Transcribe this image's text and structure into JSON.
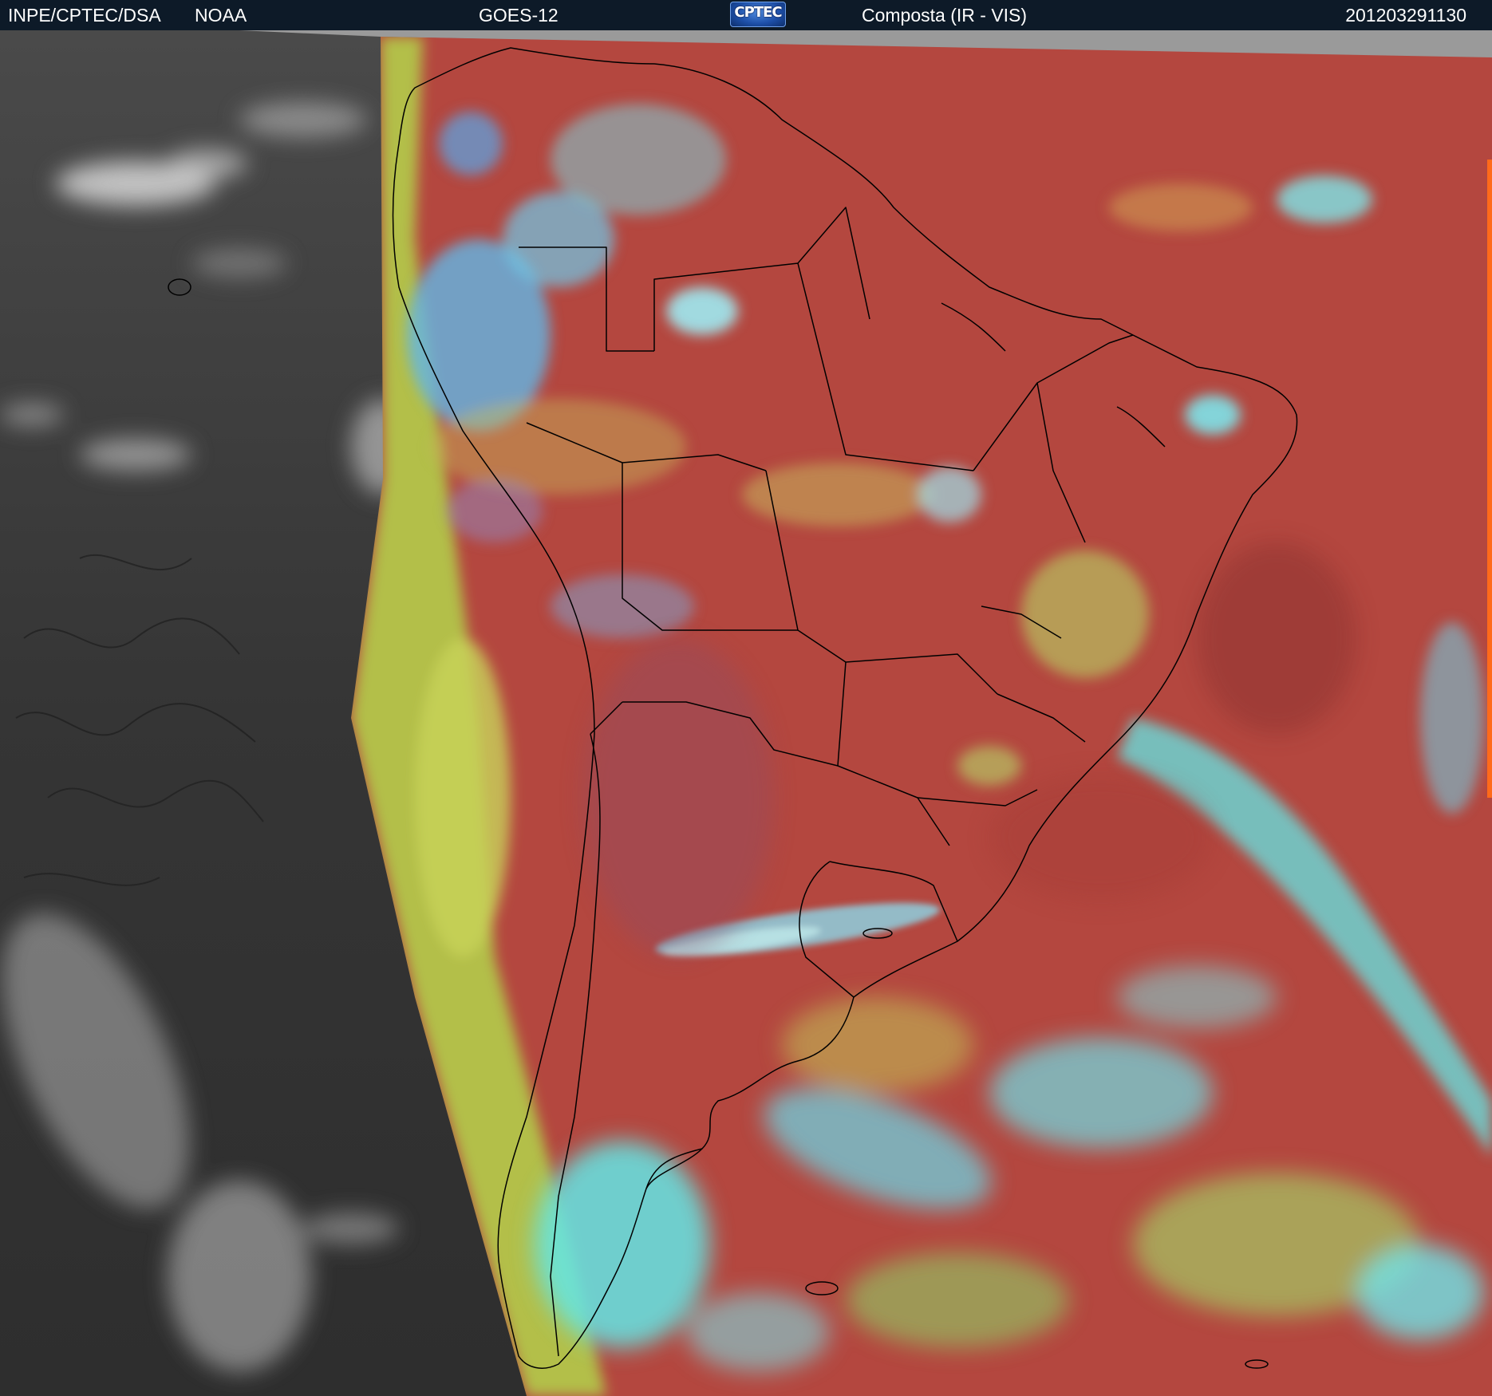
{
  "header": {
    "agency": "INPE/CPTEC/DSA",
    "source": "NOAA",
    "satellite": "GOES-12",
    "logo_text": "CPTEC",
    "product": "Composta (IR - VIS)",
    "timestamp": "201203291130"
  },
  "map": {
    "region": "South America",
    "icon": "satellite-image"
  },
  "colors": {
    "header_bg": "#0d1a28",
    "ir_gray": "#3a3a3a",
    "land_red": "#b4473f",
    "cloud_cyan": "#63e6e6",
    "cloud_green": "#a8e05a",
    "borders": "#000000"
  }
}
